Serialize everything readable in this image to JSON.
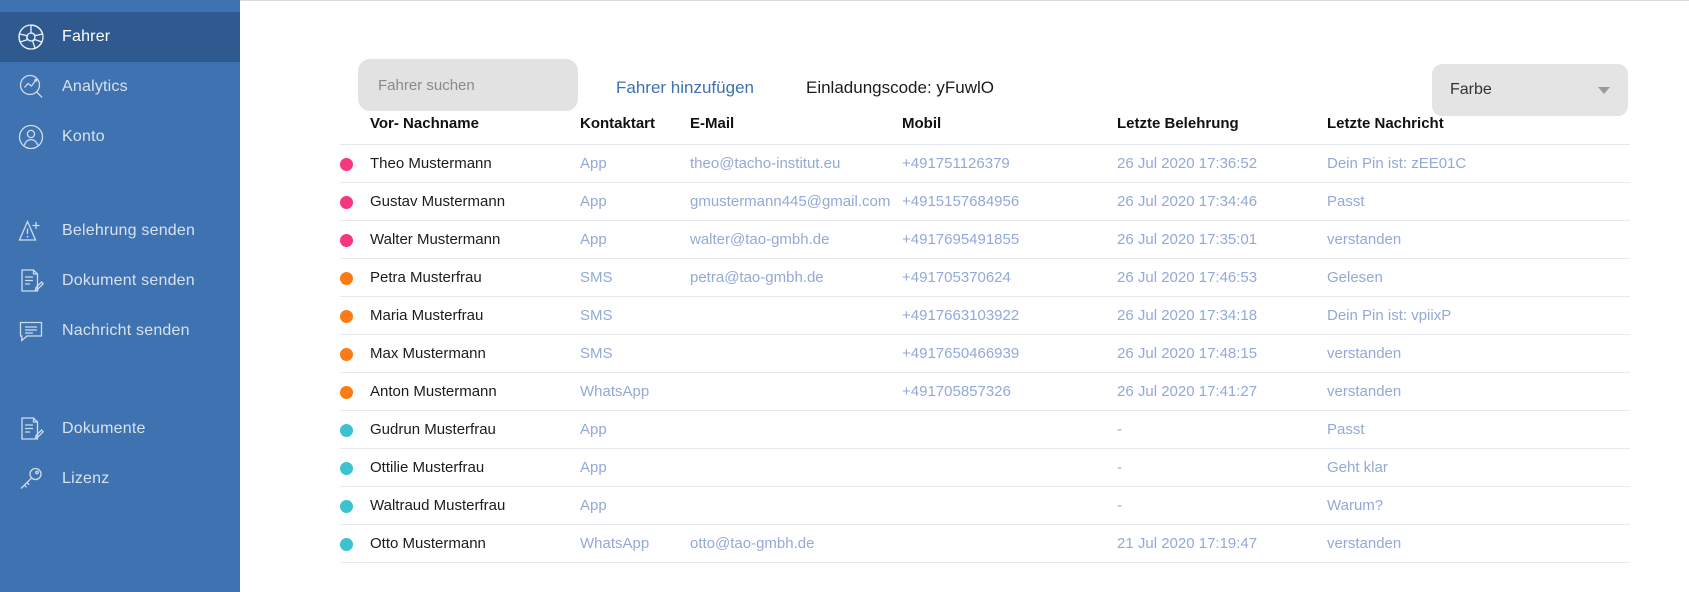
{
  "sidebar": {
    "items": [
      {
        "label": "Fahrer",
        "icon": "steering-wheel-icon",
        "active": true,
        "group": 0
      },
      {
        "label": "Analytics",
        "icon": "analytics-icon",
        "active": false,
        "group": 0
      },
      {
        "label": "Konto",
        "icon": "account-icon",
        "active": false,
        "group": 0
      },
      {
        "label": "Belehrung senden",
        "icon": "warning-send-icon",
        "active": false,
        "group": 1
      },
      {
        "label": "Dokument senden",
        "icon": "document-send-icon",
        "active": false,
        "group": 1
      },
      {
        "label": "Nachricht senden",
        "icon": "message-send-icon",
        "active": false,
        "group": 1
      },
      {
        "label": "Dokumente",
        "icon": "documents-icon",
        "active": false,
        "group": 2
      },
      {
        "label": "Lizenz",
        "icon": "key-icon",
        "active": false,
        "group": 2
      }
    ]
  },
  "toolbar": {
    "search_placeholder": "Fahrer suchen",
    "search_value": "",
    "add_driver_label": "Fahrer hinzufügen",
    "invitation_code": "Einladungscode: yFuwlO",
    "color_select_label": "Farbe",
    "color_select_arrow": "chevron-down-icon"
  },
  "table": {
    "columns": [
      "",
      "Vor- Nachname",
      "Kontaktart",
      "E-Mail",
      "Mobil",
      "Letzte Belehrung",
      "Letzte Nachricht"
    ],
    "dot_colors": {
      "pink": "#f6367e",
      "orange": "#f97c16",
      "teal": "#3cc3cd"
    },
    "rows": [
      {
        "dot": "pink",
        "name": "Theo Mustermann",
        "kontaktart": "App",
        "email": "theo@tacho-institut.eu",
        "mobil": "+491751126379",
        "letzte_belehrung": "26 Jul 2020 17:36:52",
        "letzte_nachricht": "Dein Pin ist: zEE01C"
      },
      {
        "dot": "pink",
        "name": "Gustav Mustermann",
        "kontaktart": "App",
        "email": "gmustermann445@gmail.com",
        "mobil": "+4915157684956",
        "letzte_belehrung": "26 Jul 2020 17:34:46",
        "letzte_nachricht": "Passt"
      },
      {
        "dot": "pink",
        "name": "Walter Mustermann",
        "kontaktart": "App",
        "email": "walter@tao-gmbh.de",
        "mobil": "+4917695491855",
        "letzte_belehrung": "26 Jul 2020 17:35:01",
        "letzte_nachricht": "verstanden"
      },
      {
        "dot": "orange",
        "name": "Petra Musterfrau",
        "kontaktart": "SMS",
        "email": "petra@tao-gmbh.de",
        "mobil": "+491705370624",
        "letzte_belehrung": "26 Jul 2020 17:46:53",
        "letzte_nachricht": "Gelesen"
      },
      {
        "dot": "orange",
        "name": "Maria Musterfrau",
        "kontaktart": "SMS",
        "email": "",
        "mobil": "+4917663103922",
        "letzte_belehrung": "26 Jul 2020 17:34:18",
        "letzte_nachricht": "Dein Pin ist: vpiixP"
      },
      {
        "dot": "orange",
        "name": "Max Mustermann",
        "kontaktart": "SMS",
        "email": "",
        "mobil": "+4917650466939",
        "letzte_belehrung": "26 Jul 2020 17:48:15",
        "letzte_nachricht": "verstanden"
      },
      {
        "dot": "orange",
        "name": "Anton Mustermann",
        "kontaktart": "WhatsApp",
        "email": "",
        "mobil": "+491705857326",
        "letzte_belehrung": "26 Jul 2020 17:41:27",
        "letzte_nachricht": "verstanden"
      },
      {
        "dot": "teal",
        "name": "Gudrun Musterfrau",
        "kontaktart": "App",
        "email": "",
        "mobil": "",
        "letzte_belehrung": "-",
        "letzte_nachricht": "Passt"
      },
      {
        "dot": "teal",
        "name": "Ottilie Musterfrau",
        "kontaktart": "App",
        "email": "",
        "mobil": "",
        "letzte_belehrung": "-",
        "letzte_nachricht": "Geht klar"
      },
      {
        "dot": "teal",
        "name": "Waltraud Musterfrau",
        "kontaktart": "App",
        "email": "",
        "mobil": "",
        "letzte_belehrung": "-",
        "letzte_nachricht": "Warum?"
      },
      {
        "dot": "teal",
        "name": "Otto Mustermann",
        "kontaktart": "WhatsApp",
        "email": "otto@tao-gmbh.de",
        "mobil": "",
        "letzte_belehrung": "21 Jul 2020 17:19:47",
        "letzte_nachricht": "verstanden"
      }
    ]
  }
}
